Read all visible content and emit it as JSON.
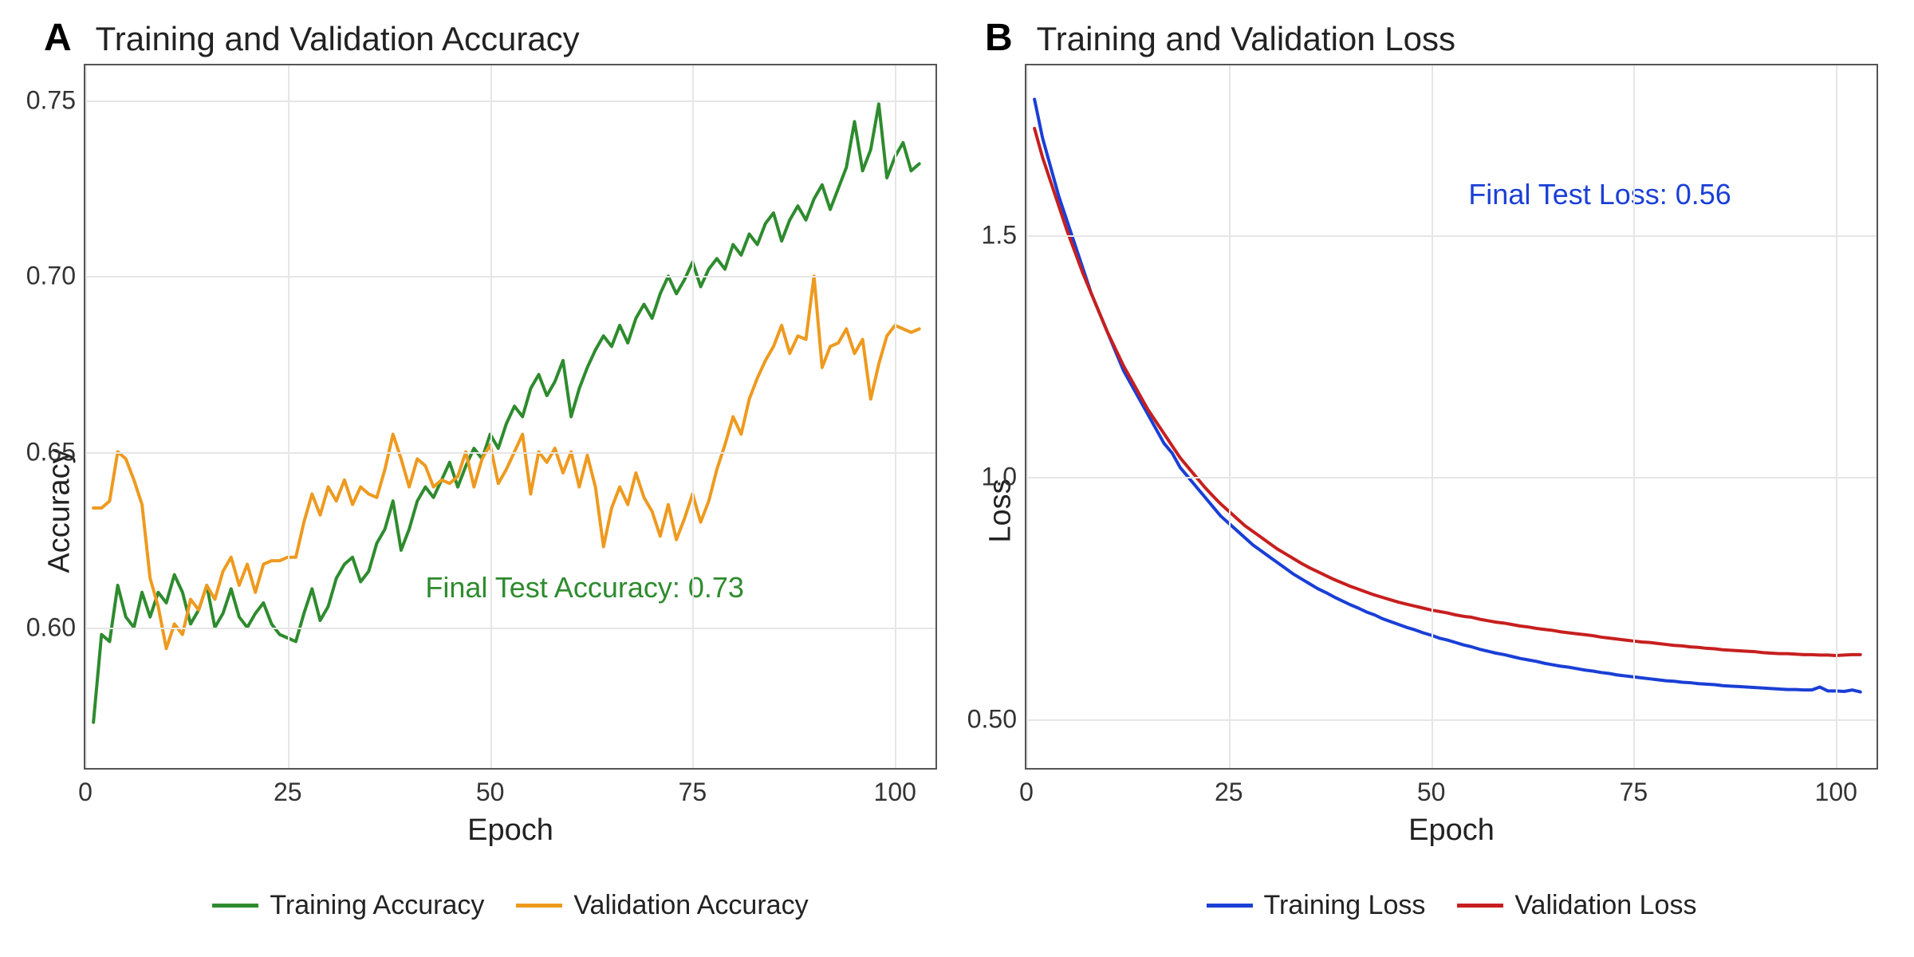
{
  "chart_data": [
    {
      "type": "line",
      "panel_letter": "A",
      "title": "Training and Validation Accuracy",
      "xlabel": "Epoch",
      "ylabel": "Accuracy",
      "xlim": [
        0,
        105
      ],
      "ylim": [
        0.56,
        0.76
      ],
      "xticks": [
        0,
        25,
        50,
        75,
        100
      ],
      "yticks": [
        0.6,
        0.65,
        0.7,
        0.75
      ],
      "annotation": {
        "text": "Final Test Accuracy: 0.73",
        "color": "#2e8b2e"
      },
      "series": [
        {
          "name": "Training Accuracy",
          "color": "#2e8b2e",
          "x": [
            1,
            2,
            3,
            4,
            5,
            6,
            7,
            8,
            9,
            10,
            11,
            12,
            13,
            14,
            15,
            16,
            17,
            18,
            19,
            20,
            21,
            22,
            23,
            24,
            25,
            26,
            27,
            28,
            29,
            30,
            31,
            32,
            33,
            34,
            35,
            36,
            37,
            38,
            39,
            40,
            41,
            42,
            43,
            44,
            45,
            46,
            47,
            48,
            49,
            50,
            51,
            52,
            53,
            54,
            55,
            56,
            57,
            58,
            59,
            60,
            61,
            62,
            63,
            64,
            65,
            66,
            67,
            68,
            69,
            70,
            71,
            72,
            73,
            74,
            75,
            76,
            77,
            78,
            79,
            80,
            81,
            82,
            83,
            84,
            85,
            86,
            87,
            88,
            89,
            90,
            91,
            92,
            93,
            94,
            95,
            96,
            97,
            98,
            99,
            100,
            101,
            102,
            103
          ],
          "values": [
            0.573,
            0.598,
            0.596,
            0.612,
            0.603,
            0.6,
            0.61,
            0.603,
            0.61,
            0.607,
            0.615,
            0.61,
            0.601,
            0.605,
            0.612,
            0.6,
            0.604,
            0.611,
            0.603,
            0.6,
            0.604,
            0.607,
            0.601,
            0.598,
            0.597,
            0.596,
            0.604,
            0.611,
            0.602,
            0.606,
            0.614,
            0.618,
            0.62,
            0.613,
            0.616,
            0.624,
            0.628,
            0.636,
            0.622,
            0.628,
            0.636,
            0.64,
            0.637,
            0.642,
            0.647,
            0.64,
            0.646,
            0.651,
            0.648,
            0.655,
            0.651,
            0.658,
            0.663,
            0.66,
            0.668,
            0.672,
            0.666,
            0.67,
            0.676,
            0.66,
            0.668,
            0.674,
            0.679,
            0.683,
            0.68,
            0.686,
            0.681,
            0.688,
            0.692,
            0.688,
            0.695,
            0.7,
            0.695,
            0.699,
            0.704,
            0.697,
            0.702,
            0.705,
            0.702,
            0.709,
            0.706,
            0.712,
            0.709,
            0.715,
            0.718,
            0.71,
            0.716,
            0.72,
            0.716,
            0.722,
            0.726,
            0.719,
            0.725,
            0.731,
            0.744,
            0.73,
            0.736,
            0.749,
            0.728,
            0.734,
            0.738,
            0.73,
            0.732
          ]
        },
        {
          "name": "Validation Accuracy",
          "color": "#ee9a1f",
          "x": [
            1,
            2,
            3,
            4,
            5,
            6,
            7,
            8,
            9,
            10,
            11,
            12,
            13,
            14,
            15,
            16,
            17,
            18,
            19,
            20,
            21,
            22,
            23,
            24,
            25,
            26,
            27,
            28,
            29,
            30,
            31,
            32,
            33,
            34,
            35,
            36,
            37,
            38,
            39,
            40,
            41,
            42,
            43,
            44,
            45,
            46,
            47,
            48,
            49,
            50,
            51,
            52,
            53,
            54,
            55,
            56,
            57,
            58,
            59,
            60,
            61,
            62,
            63,
            64,
            65,
            66,
            67,
            68,
            69,
            70,
            71,
            72,
            73,
            74,
            75,
            76,
            77,
            78,
            79,
            80,
            81,
            82,
            83,
            84,
            85,
            86,
            87,
            88,
            89,
            90,
            91,
            92,
            93,
            94,
            95,
            96,
            97,
            98,
            99,
            100,
            101,
            102,
            103
          ],
          "values": [
            0.634,
            0.634,
            0.636,
            0.65,
            0.648,
            0.642,
            0.635,
            0.614,
            0.606,
            0.594,
            0.601,
            0.598,
            0.608,
            0.605,
            0.612,
            0.608,
            0.616,
            0.62,
            0.612,
            0.618,
            0.61,
            0.618,
            0.619,
            0.619,
            0.62,
            0.62,
            0.63,
            0.638,
            0.632,
            0.64,
            0.636,
            0.642,
            0.635,
            0.64,
            0.638,
            0.637,
            0.645,
            0.655,
            0.648,
            0.64,
            0.648,
            0.646,
            0.64,
            0.642,
            0.641,
            0.643,
            0.65,
            0.64,
            0.648,
            0.652,
            0.641,
            0.645,
            0.65,
            0.655,
            0.638,
            0.65,
            0.647,
            0.651,
            0.644,
            0.65,
            0.64,
            0.649,
            0.64,
            0.623,
            0.634,
            0.64,
            0.635,
            0.644,
            0.637,
            0.633,
            0.626,
            0.635,
            0.625,
            0.631,
            0.638,
            0.63,
            0.636,
            0.645,
            0.652,
            0.66,
            0.655,
            0.665,
            0.671,
            0.676,
            0.68,
            0.686,
            0.678,
            0.683,
            0.682,
            0.7,
            0.674,
            0.68,
            0.681,
            0.685,
            0.678,
            0.682,
            0.665,
            0.675,
            0.683,
            0.686,
            0.685,
            0.684,
            0.685
          ]
        }
      ]
    },
    {
      "type": "line",
      "panel_letter": "B",
      "title": "Training and Validation Loss",
      "xlabel": "Epoch",
      "ylabel": "Loss",
      "xlim": [
        0,
        105
      ],
      "ylim": [
        0.4,
        1.85
      ],
      "xticks": [
        0,
        25,
        50,
        75,
        100
      ],
      "yticks": [
        0.5,
        1.0,
        1.5
      ],
      "annotation": {
        "text": "Final Test Loss: 0.56",
        "color": "#1a3fd6"
      },
      "series": [
        {
          "name": "Training Loss",
          "color": "#1a3fd6",
          "x": [
            1,
            2,
            3,
            4,
            5,
            6,
            7,
            8,
            9,
            10,
            11,
            12,
            13,
            14,
            15,
            16,
            17,
            18,
            19,
            20,
            21,
            22,
            23,
            24,
            25,
            26,
            27,
            28,
            29,
            30,
            31,
            32,
            33,
            34,
            35,
            36,
            37,
            38,
            39,
            40,
            41,
            42,
            43,
            44,
            45,
            46,
            47,
            48,
            49,
            50,
            51,
            52,
            53,
            54,
            55,
            56,
            57,
            58,
            59,
            60,
            61,
            62,
            63,
            64,
            65,
            66,
            67,
            68,
            69,
            70,
            71,
            72,
            73,
            74,
            75,
            76,
            77,
            78,
            79,
            80,
            81,
            82,
            83,
            84,
            85,
            86,
            87,
            88,
            89,
            90,
            91,
            92,
            93,
            94,
            95,
            96,
            97,
            98,
            99,
            100,
            101,
            102,
            103
          ],
          "values": [
            1.78,
            1.7,
            1.64,
            1.58,
            1.53,
            1.48,
            1.43,
            1.38,
            1.34,
            1.3,
            1.26,
            1.22,
            1.19,
            1.16,
            1.13,
            1.1,
            1.07,
            1.05,
            1.02,
            1.0,
            0.98,
            0.96,
            0.94,
            0.92,
            0.905,
            0.89,
            0.875,
            0.86,
            0.848,
            0.836,
            0.824,
            0.812,
            0.8,
            0.79,
            0.78,
            0.77,
            0.762,
            0.753,
            0.745,
            0.737,
            0.73,
            0.722,
            0.716,
            0.708,
            0.702,
            0.696,
            0.69,
            0.685,
            0.679,
            0.674,
            0.668,
            0.664,
            0.659,
            0.654,
            0.65,
            0.645,
            0.641,
            0.637,
            0.634,
            0.63,
            0.626,
            0.623,
            0.62,
            0.616,
            0.613,
            0.61,
            0.608,
            0.605,
            0.602,
            0.6,
            0.597,
            0.595,
            0.592,
            0.59,
            0.588,
            0.586,
            0.584,
            0.582,
            0.58,
            0.579,
            0.577,
            0.576,
            0.574,
            0.573,
            0.572,
            0.57,
            0.569,
            0.568,
            0.567,
            0.566,
            0.565,
            0.564,
            0.563,
            0.562,
            0.562,
            0.561,
            0.561,
            0.567,
            0.559,
            0.559,
            0.558,
            0.561,
            0.557
          ]
        },
        {
          "name": "Validation Loss",
          "color": "#c71f1f",
          "x": [
            1,
            2,
            3,
            4,
            5,
            6,
            7,
            8,
            9,
            10,
            11,
            12,
            13,
            14,
            15,
            16,
            17,
            18,
            19,
            20,
            21,
            22,
            23,
            24,
            25,
            26,
            27,
            28,
            29,
            30,
            31,
            32,
            33,
            34,
            35,
            36,
            37,
            38,
            39,
            40,
            41,
            42,
            43,
            44,
            45,
            46,
            47,
            48,
            49,
            50,
            51,
            52,
            53,
            54,
            55,
            56,
            57,
            58,
            59,
            60,
            61,
            62,
            63,
            64,
            65,
            66,
            67,
            68,
            69,
            70,
            71,
            72,
            73,
            74,
            75,
            76,
            77,
            78,
            79,
            80,
            81,
            82,
            83,
            84,
            85,
            86,
            87,
            88,
            89,
            90,
            91,
            92,
            93,
            94,
            95,
            96,
            97,
            98,
            99,
            100,
            101,
            102,
            103
          ],
          "values": [
            1.72,
            1.66,
            1.61,
            1.56,
            1.51,
            1.465,
            1.42,
            1.38,
            1.34,
            1.3,
            1.265,
            1.23,
            1.2,
            1.17,
            1.14,
            1.115,
            1.09,
            1.065,
            1.04,
            1.02,
            1.0,
            0.98,
            0.962,
            0.945,
            0.93,
            0.915,
            0.9,
            0.888,
            0.876,
            0.864,
            0.852,
            0.842,
            0.832,
            0.822,
            0.813,
            0.805,
            0.797,
            0.789,
            0.782,
            0.775,
            0.769,
            0.763,
            0.757,
            0.752,
            0.747,
            0.742,
            0.738,
            0.734,
            0.73,
            0.726,
            0.723,
            0.72,
            0.716,
            0.713,
            0.711,
            0.707,
            0.704,
            0.701,
            0.699,
            0.696,
            0.693,
            0.691,
            0.688,
            0.686,
            0.684,
            0.681,
            0.679,
            0.677,
            0.675,
            0.673,
            0.67,
            0.668,
            0.666,
            0.664,
            0.662,
            0.66,
            0.659,
            0.657,
            0.655,
            0.653,
            0.652,
            0.65,
            0.649,
            0.647,
            0.646,
            0.644,
            0.643,
            0.642,
            0.641,
            0.64,
            0.638,
            0.637,
            0.636,
            0.636,
            0.635,
            0.634,
            0.634,
            0.633,
            0.633,
            0.632,
            0.633,
            0.634,
            0.634
          ]
        }
      ]
    }
  ]
}
